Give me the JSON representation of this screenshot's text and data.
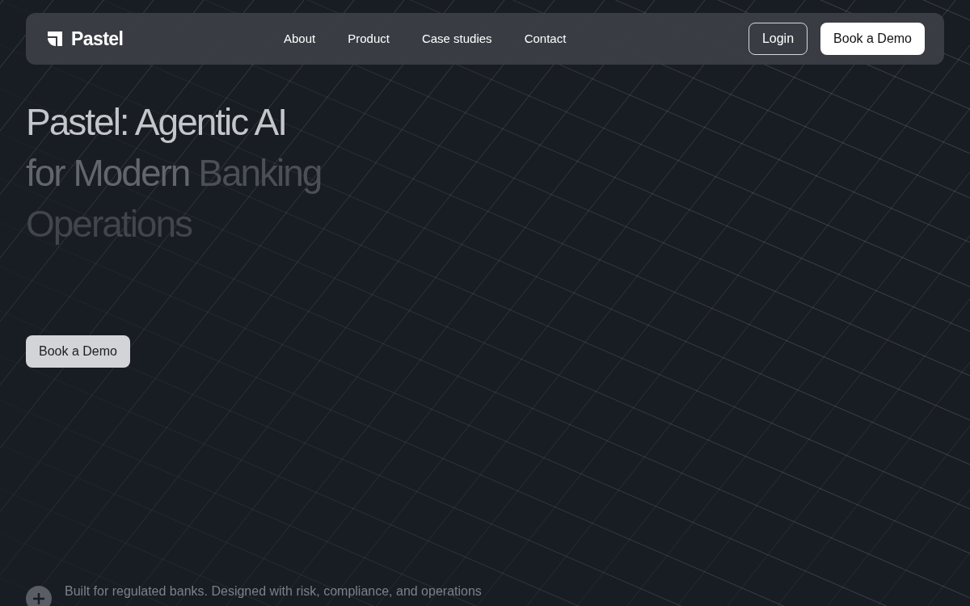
{
  "nav": {
    "brand": "Pastel",
    "links": [
      {
        "label": "About"
      },
      {
        "label": "Product"
      },
      {
        "label": "Case studies"
      },
      {
        "label": "Contact"
      }
    ],
    "login": "Login",
    "cta": "Book a Demo"
  },
  "hero": {
    "heading_lines": [
      [
        {
          "text": "Pastel: Agentic AI",
          "kind": "bright"
        }
      ],
      [
        {
          "text": "for Modern",
          "kind": "mid"
        },
        {
          "text": "Banking",
          "kind": "dim"
        }
      ],
      [
        {
          "text": "Operations",
          "kind": "faint"
        }
      ]
    ],
    "button": "Book a Demo"
  },
  "footnote": {
    "text": "Built for regulated banks. Designed with risk, compliance, and operations"
  }
}
